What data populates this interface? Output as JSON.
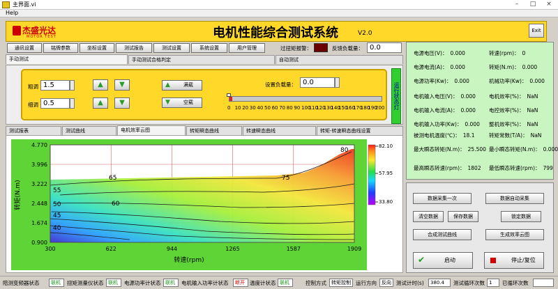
{
  "window": {
    "title": "主界面.vi",
    "menu": "Help"
  },
  "header": {
    "logo_text": "杰盛光达",
    "logo_sub": "MOTOR TEST",
    "title": "电机性能综合测试系统",
    "version": "V2.0",
    "exit_label": "Exit"
  },
  "toolbar": [
    "通讯设置",
    "铭牌参数",
    "坐标设置",
    "测试报告",
    "测试设置",
    "系统设置",
    "用户管理"
  ],
  "overtorque_alarm_label": "过扭矩报警：",
  "feedback_load_label": "反馈负载量：",
  "feedback_load_value": "0.0",
  "top_tabs": [
    "手动测试",
    "手动测试合格判定",
    "自动测试"
  ],
  "manual": {
    "coarse_label": "粗调",
    "coarse_value": "1.5",
    "fine_label": "细调",
    "fine_value": "0.5",
    "excite_label": "满载",
    "unload_label": "空载",
    "load_set_label": "设置负载量：",
    "load_set_value": "0.0",
    "slider_value": 0,
    "slider_ticks": [
      "0",
      "10",
      "20",
      "30",
      "40",
      "50",
      "60",
      "70",
      "80",
      "90",
      "100",
      "110",
      "120",
      "130",
      "140",
      "150",
      "160",
      "170",
      "180",
      "190",
      "200"
    ],
    "side_label": "运行状态灯"
  },
  "chart_tabs": [
    "测试报表",
    "测试曲线",
    "电机效率云图",
    "转矩瞬态曲线",
    "转速瞬态曲线",
    "转矩-转速瞬态曲线设置"
  ],
  "chart_data": {
    "type": "heatmap",
    "xlabel": "转速(rpm)",
    "ylabel": "转矩(N.m)",
    "x_ticks": [
      "300",
      "622",
      "944",
      "1265",
      "1587",
      "1909"
    ],
    "y_ticks": [
      "4.770",
      "3.996",
      "3.222",
      "2.448",
      "1.674",
      "0.900"
    ],
    "xlim": [
      300,
      1909
    ],
    "ylim": [
      0.9,
      4.77
    ],
    "colorbar_ticks": [
      "82.10",
      "57.95",
      "33.80"
    ],
    "contour_labels": [
      "80",
      "75",
      "65",
      "60",
      "55",
      "50",
      "45",
      "40"
    ]
  },
  "readouts": [
    {
      "label": "电源电压(V)：",
      "value": "0.000"
    },
    {
      "label": "转速(rpm)：",
      "value": "0"
    },
    {
      "label": "电源电流(A)：",
      "value": "0.000"
    },
    {
      "label": "转矩(N.m)：",
      "value": "0.000"
    },
    {
      "label": "电源功率(Kw)：",
      "value": "0.000"
    },
    {
      "label": "机械功率(Kw)：",
      "value": "0.000"
    },
    {
      "label": "电机输入电压(V)：",
      "value": "0.000"
    },
    {
      "label": "电机效率(%)：",
      "value": "NaN"
    },
    {
      "label": "电机输入电流(A)：",
      "value": "0.000"
    },
    {
      "label": "电控效率(%)：",
      "value": "NaN"
    },
    {
      "label": "电机输入功率(Kw)：",
      "value": "0.000"
    },
    {
      "label": "整机效率(%)：",
      "value": "NaN"
    },
    {
      "label": "被测电机温度(℃)：",
      "value": "18.1"
    },
    {
      "label": "转矩常数(T/A)：",
      "value": "NaN"
    },
    {
      "label": "最大瞬态转矩(N.m)：",
      "value": "25.500"
    },
    {
      "label": "最小瞬态转矩(N.m)：",
      "value": "0.000"
    },
    {
      "label": "最高瞬态转速(rpm)：",
      "value": "1802"
    },
    {
      "label": "最低瞬态转速(rpm)：",
      "value": "799"
    }
  ],
  "actions": [
    "数据采集一次",
    "数据自动采集",
    "清空数据",
    "保存数据",
    "锁定数据",
    "合成测试曲线",
    "生成效率云图"
  ],
  "start_label": "启动",
  "stop_label": "停止/复位",
  "status": {
    "items": [
      {
        "label": "陪测变频器状态",
        "value": "联机"
      },
      {
        "label": "扭矩测量仪状态",
        "value": "联机"
      },
      {
        "label": "电源功率计状态",
        "value": "联机"
      },
      {
        "label": "电机输入功率计状态",
        "value": "断开"
      },
      {
        "label": "温度计状态",
        "value": "联机"
      }
    ],
    "control_mode_label": "控制方式",
    "control_mode_value": "转矩控制",
    "run_dir_label": "运行方向",
    "run_dir_value": "反向",
    "test_time_label": "测试计时(s)",
    "test_time_value": "380.4",
    "cycles_label": "测试循环次数",
    "cycles_value": "1",
    "done_label": "已循环次数",
    "done_value": ""
  },
  "colors": {
    "header_yellow": "#ffd82a",
    "panel_green": "#c9f5c0",
    "ok_green": "#1a9e1a",
    "bad_red": "#d40000"
  }
}
